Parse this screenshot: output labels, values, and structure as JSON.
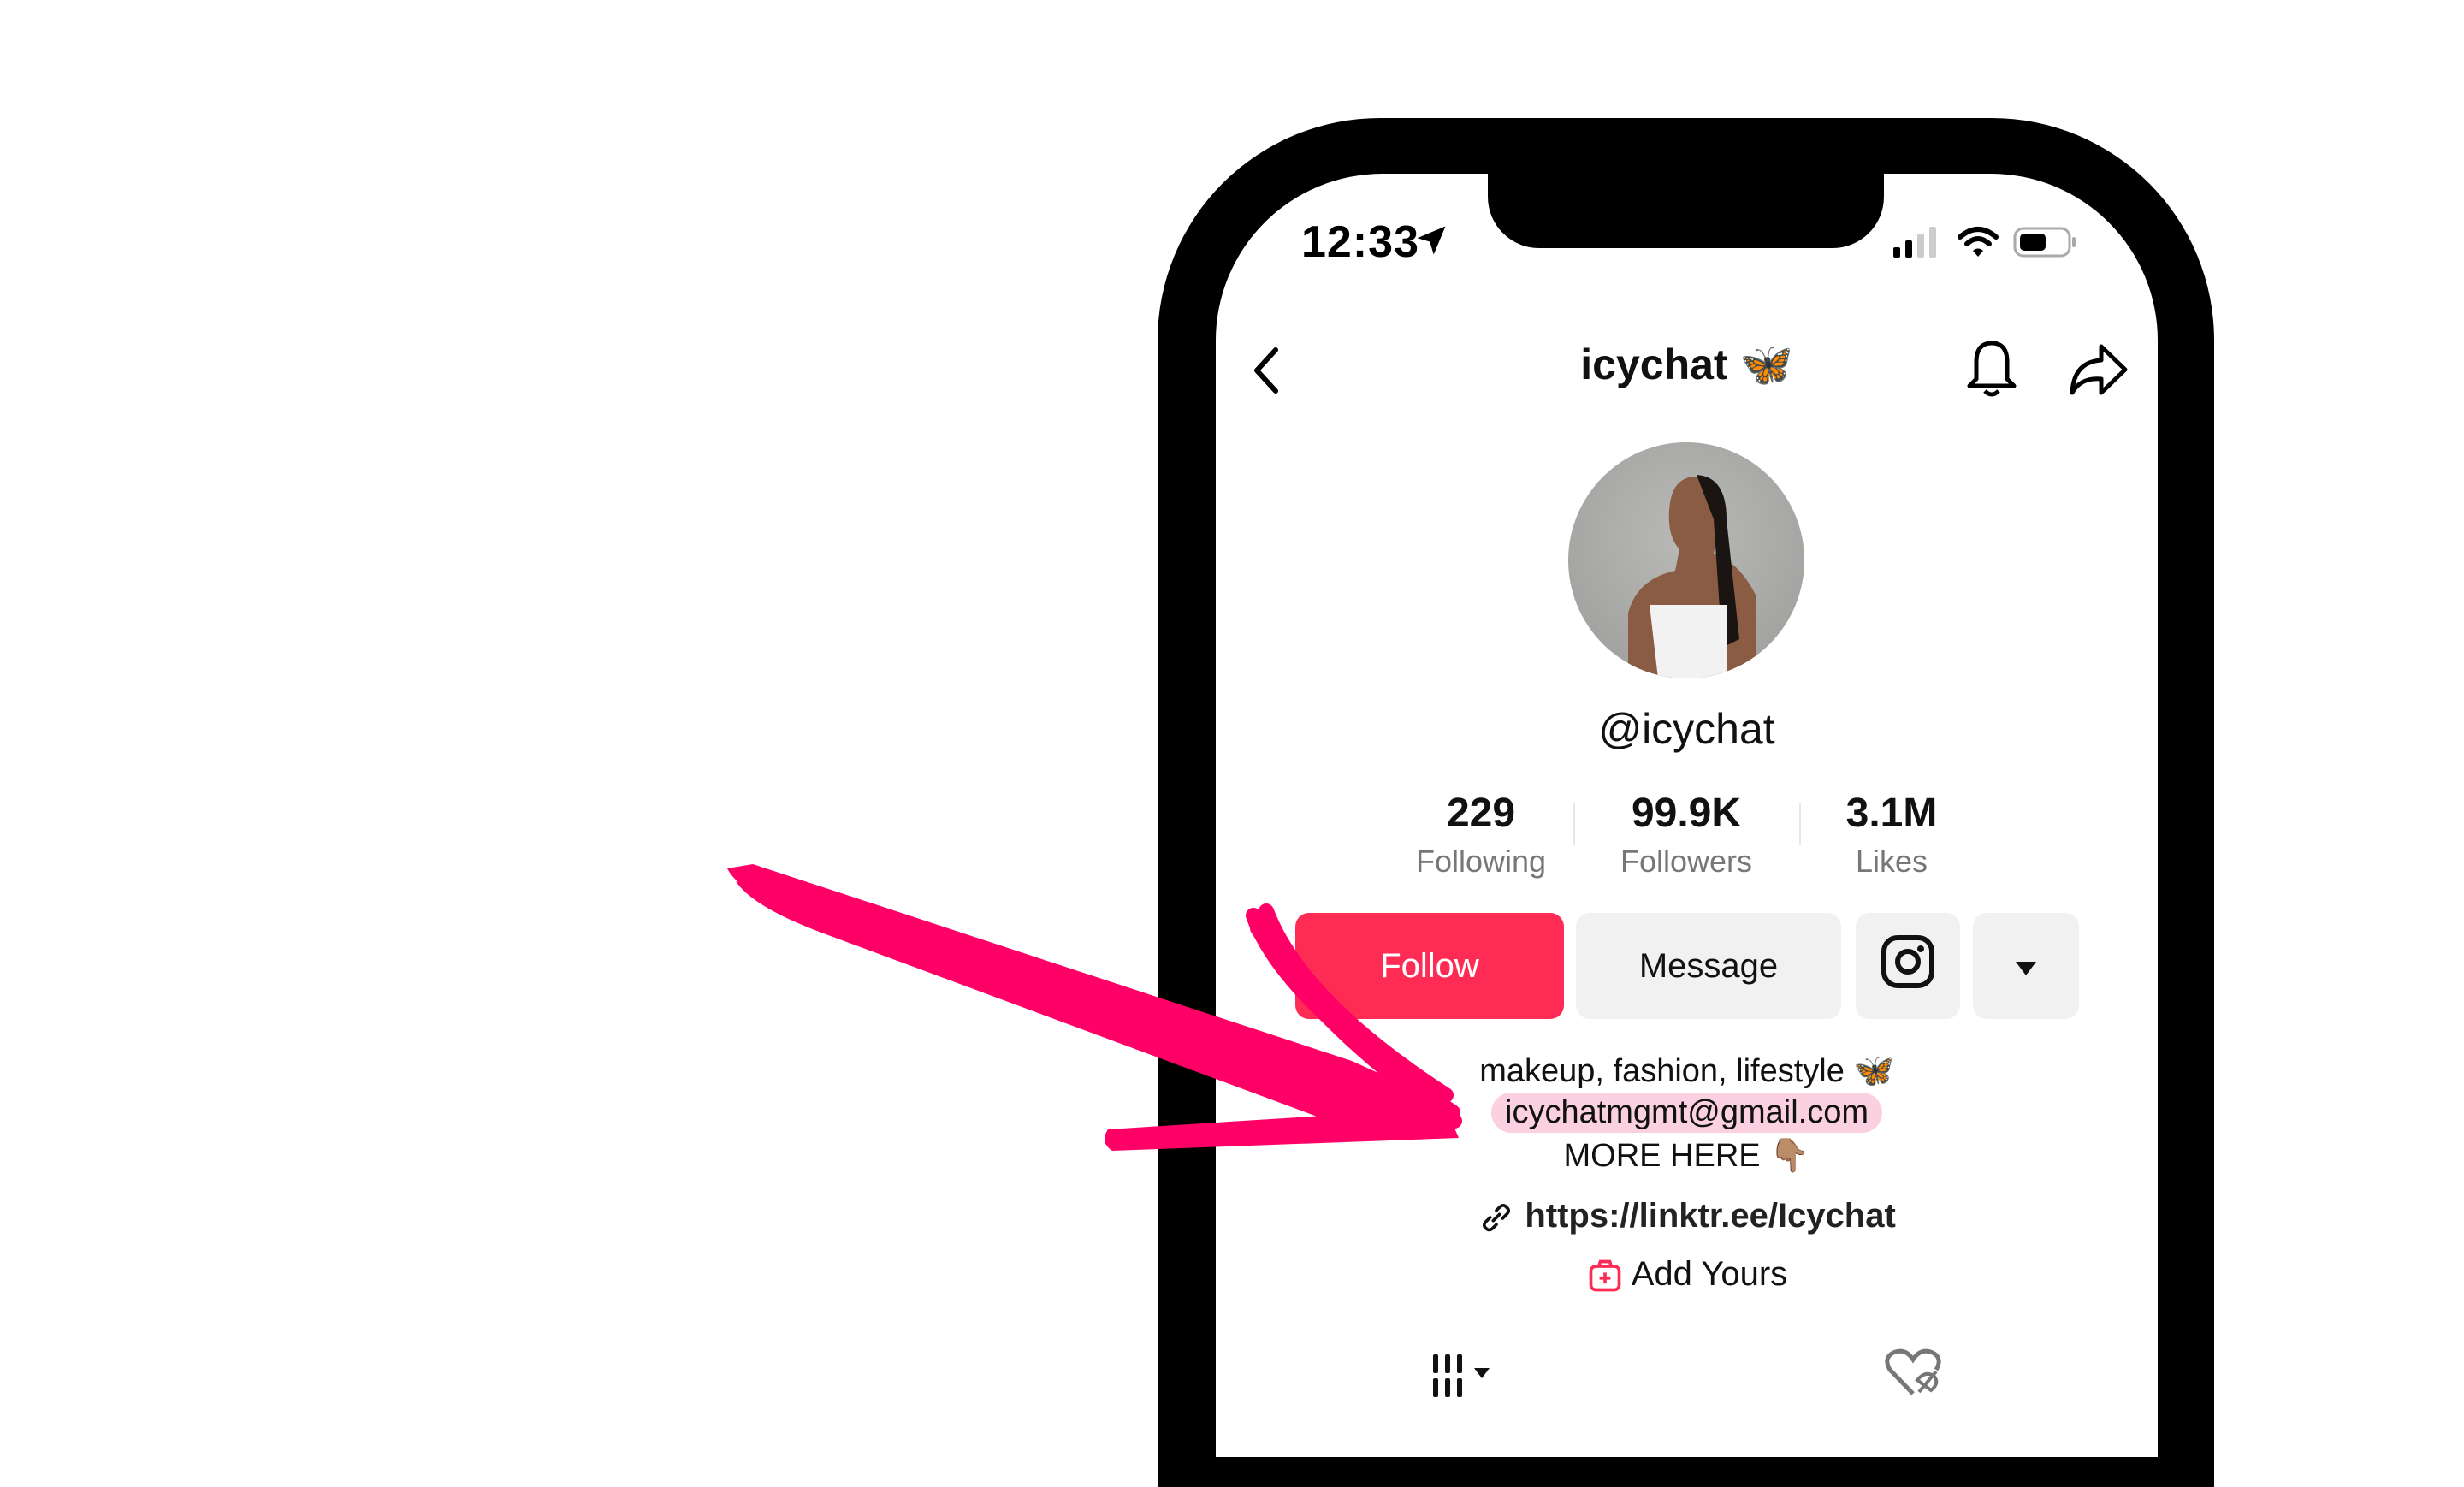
{
  "status_bar": {
    "time": "12:33",
    "icons": [
      "location-arrow-icon",
      "cellular-signal-icon",
      "wifi-icon",
      "battery-icon"
    ]
  },
  "header": {
    "title": "icychat",
    "title_emoji": "🦋",
    "back_icon": "chevron-left-icon",
    "bell_icon": "bell-icon",
    "share_icon": "share-icon"
  },
  "profile": {
    "handle": "@icychat",
    "stats": [
      {
        "value": "229",
        "label": "Following"
      },
      {
        "value": "99.9K",
        "label": "Followers"
      },
      {
        "value": "3.1M",
        "label": "Likes"
      }
    ],
    "buttons": {
      "follow": "Follow",
      "message": "Message",
      "instagram_icon": "instagram-icon",
      "more_icon": "caret-down-icon"
    },
    "bio": {
      "line1": "makeup, fashion, lifestyle 🦋",
      "email": "icychatmgmt@gmail.com",
      "line3": "MORE HERE 👇🏽"
    },
    "link": "https://linktr.ee/Icychat",
    "add_yours": "Add Yours"
  },
  "tabs": {
    "videos_icon": "grid-icon",
    "liked_icon": "liked-hidden-icon"
  },
  "annotation": {
    "color": "#ff0066",
    "type": "hand-drawn-arrow"
  },
  "colors": {
    "accent": "#fe2c55",
    "email_highlight": "#fbd0e0",
    "button_gray": "#f1f1f2"
  }
}
